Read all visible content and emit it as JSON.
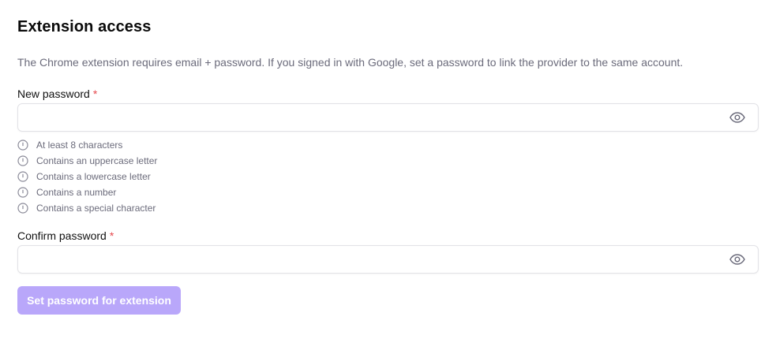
{
  "section": {
    "title": "Extension access",
    "description": "The Chrome extension requires email + password. If you signed in with Google, set a password to link the provider to the same account."
  },
  "new_password": {
    "label": "New password",
    "required_mark": "*",
    "value": "",
    "eye_icon": "eye-icon"
  },
  "requirements": [
    {
      "text": "At least 8 characters",
      "icon": "info-circle-icon"
    },
    {
      "text": "Contains an uppercase letter",
      "icon": "info-circle-icon"
    },
    {
      "text": "Contains a lowercase letter",
      "icon": "info-circle-icon"
    },
    {
      "text": "Contains a number",
      "icon": "info-circle-icon"
    },
    {
      "text": "Contains a special character",
      "icon": "info-circle-icon"
    }
  ],
  "confirm_password": {
    "label": "Confirm password",
    "required_mark": "*",
    "value": "",
    "eye_icon": "eye-icon"
  },
  "submit": {
    "label": "Set password for extension",
    "disabled": true
  },
  "colors": {
    "accent_disabled": "#b9a7fa",
    "required": "#e5484d",
    "muted_text": "#6b6b7b",
    "border": "#e2e2e6"
  }
}
